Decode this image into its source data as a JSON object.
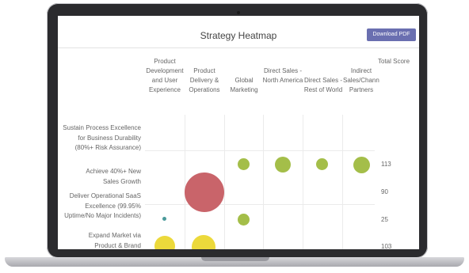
{
  "page": {
    "title": "Strategy Heatmap",
    "download_label": "Download PDF"
  },
  "columns": [
    "Product Development and User Experience",
    "Product Delivery & Operations",
    "Global Marketing",
    "Direct Sales - North America",
    "Direct Sales - Rest of World",
    "Indirect Sales/Channel Partners"
  ],
  "total_header": "Total Score",
  "rows": [
    {
      "label": "Sustain Process Excellence for Business Durability (80%+ Risk Assurance)",
      "score": "113"
    },
    {
      "label": "Achieve 40%+ New Sales Growth",
      "score": "90"
    },
    {
      "label": "Deliver Operational SaaS Excellence (99.95% Uptime/No Major Incidents)",
      "score": "25"
    },
    {
      "label": "Expand Market via Product & Brand",
      "score": "103"
    }
  ],
  "colors": {
    "green": "#a4be49",
    "red": "#c9646a",
    "yellow": "#ecd93b",
    "teal": "#4a9a9a",
    "button": "#6a6fb0"
  }
}
